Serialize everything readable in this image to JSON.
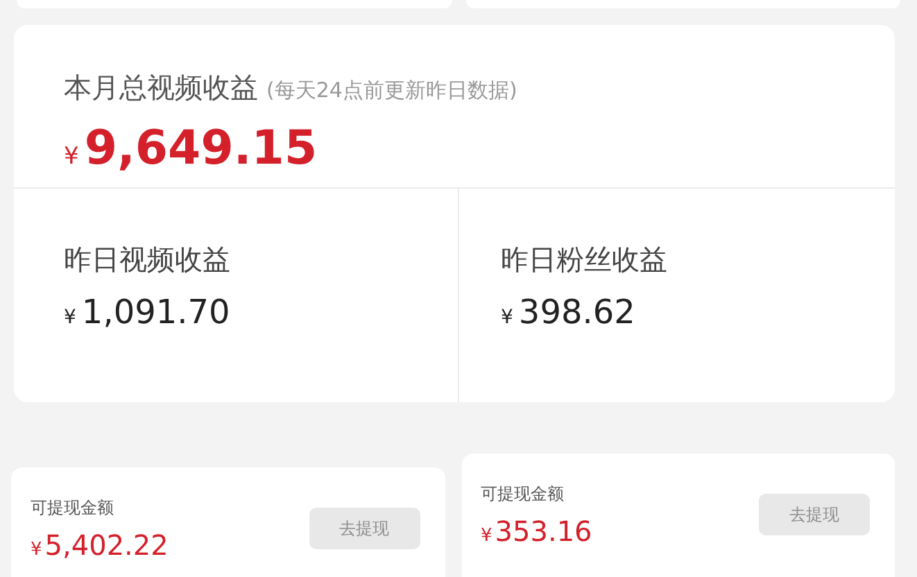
{
  "month_total": {
    "title": "本月总视频收益",
    "note": "(每天24点前更新昨日数据)",
    "currency": "¥",
    "amount": "9,649.15"
  },
  "yesterday": [
    {
      "label": "昨日视频收益",
      "currency": "¥",
      "amount": "1,091.70"
    },
    {
      "label": "昨日粉丝收益",
      "currency": "¥",
      "amount": "398.62"
    }
  ],
  "withdraw_cards": [
    {
      "label": "可提现金额",
      "currency": "¥",
      "amount": "5,402.22",
      "button": "去提现",
      "disabled": true
    },
    {
      "label": "可提现金额",
      "currency": "¥",
      "amount": "353.16",
      "button": "去提现",
      "disabled": true
    }
  ]
}
